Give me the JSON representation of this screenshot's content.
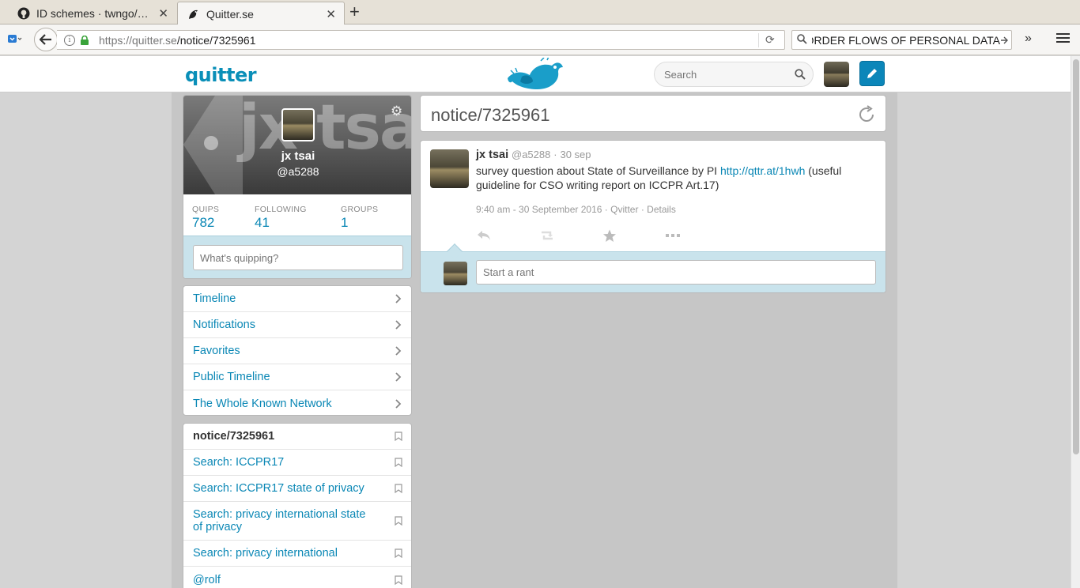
{
  "browser": {
    "tabs": [
      {
        "label": "ID schemes · twngo/…",
        "icon": "github-icon"
      },
      {
        "label": "Quitter.se",
        "icon": "quitter-bird-icon"
      }
    ],
    "url_prefix": "https://quitter.se",
    "url_path": "/notice/7325961",
    "search_value": "BORDER FLOWS OF PERSONAL DATA"
  },
  "site": {
    "logo": "quitter",
    "search_placeholder": "Search"
  },
  "profile": {
    "banner_text": "jx tsai",
    "name": "jx tsai",
    "handle": "@a5288",
    "stats": [
      {
        "label": "QUIPS",
        "value": "782"
      },
      {
        "label": "FOLLOWING",
        "value": "41"
      },
      {
        "label": "GROUPS",
        "value": "1"
      }
    ],
    "quip_placeholder": "What's quipping?"
  },
  "main_menu": [
    {
      "label": "Timeline"
    },
    {
      "label": "Notifications"
    },
    {
      "label": "Favorites"
    },
    {
      "label": "Public Timeline"
    },
    {
      "label": "The Whole Known Network"
    }
  ],
  "bookmarks": [
    {
      "label": "notice/7325961",
      "current": true
    },
    {
      "label": "Search: ICCPR17"
    },
    {
      "label": "Search: ICCPR17 state of privacy"
    },
    {
      "label": "Search: privacy international state of privacy"
    },
    {
      "label": "Search: privacy international"
    },
    {
      "label": "@rolf"
    }
  ],
  "stream": {
    "title": "notice/7325961"
  },
  "notice": {
    "author_name": "jx tsai",
    "author_handle": "@a5288",
    "date_short": "30 sep",
    "text_before": "survey question about State of Surveillance by PI ",
    "link": "http://qttr.at/1hwh",
    "text_after": " (useful guideline for CSO writing report on ICCPR Art.17)",
    "timestamp": "9:40 am - 30 September 2016",
    "source": "Qvitter",
    "details": "Details",
    "reply_placeholder": "Start a rant"
  },
  "colors": {
    "accent": "#0a87b5",
    "reply_bg": "#c9e3ec",
    "page_bg": "#d4d4d4"
  }
}
